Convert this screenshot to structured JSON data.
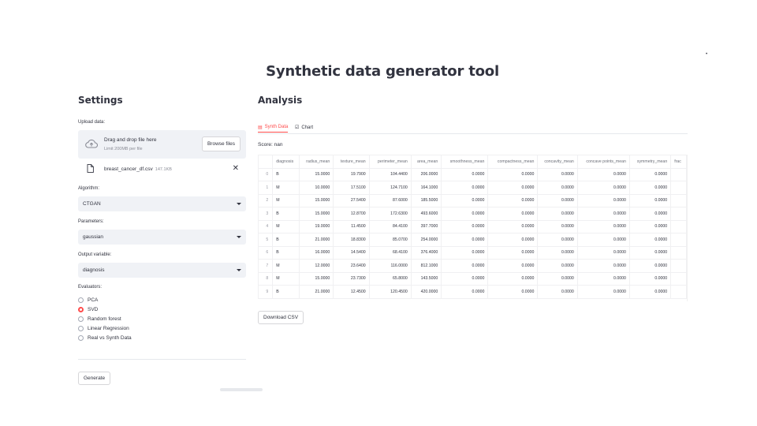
{
  "page": {
    "title": "Synthetic data generator tool",
    "menu_icon": "kebab-menu"
  },
  "sidebar": {
    "heading": "Settings",
    "upload": {
      "label": "Upload data:",
      "drop_text": "Drag and drop file here",
      "limit_text": "Limit 200MB per file",
      "browse_label": "Browse files",
      "file_name": "breast_cancer_df.csv",
      "file_size": "147.1KB"
    },
    "algorithm": {
      "label": "Algorithm:",
      "value": "CTGAN"
    },
    "parameters": {
      "label": "Parameters:",
      "value": "gaussian"
    },
    "output_variable": {
      "label": "Output variable:",
      "value": "diagnosis"
    },
    "evaluators": {
      "label": "Evaluators:",
      "options": [
        "PCA",
        "SVD",
        "Random forest",
        "Linear Regression",
        "Real vs Synth Data"
      ],
      "selected": "SVD"
    },
    "generate_label": "Generate"
  },
  "main": {
    "heading": "Analysis",
    "tabs": [
      {
        "label": "Synth Data",
        "icon": "table-icon",
        "active": true
      },
      {
        "label": "Chart",
        "icon": "chart-icon",
        "active": false
      }
    ],
    "score_text": "Score: nan",
    "table": {
      "columns": [
        "",
        "diagnosis",
        "radius_mean",
        "texture_mean",
        "perimeter_mean",
        "area_mean",
        "smoothness_mean",
        "compactness_mean",
        "concavity_mean",
        "concave points_mean",
        "symmetry_mean",
        "frac"
      ],
      "rows": [
        [
          "0",
          "B",
          "15.0000",
          "19.7900",
          "104.4400",
          "206.0000",
          "0.0000",
          "0.0000",
          "0.0000",
          "0.0000",
          "0.0000",
          ""
        ],
        [
          "1",
          "M",
          "10.0000",
          "17.5100",
          "124.7100",
          "164.1000",
          "0.0000",
          "0.0000",
          "0.0000",
          "0.0000",
          "0.0000",
          ""
        ],
        [
          "2",
          "M",
          "15.0000",
          "27.5400",
          "87.6000",
          "185.5000",
          "0.0000",
          "0.0000",
          "0.0000",
          "0.0000",
          "0.0000",
          ""
        ],
        [
          "3",
          "B",
          "15.0000",
          "12.8700",
          "172.6300",
          "493.6000",
          "0.0000",
          "0.0000",
          "0.0000",
          "0.0000",
          "0.0000",
          ""
        ],
        [
          "4",
          "M",
          "19.0000",
          "11.4500",
          "84.4100",
          "397.7000",
          "0.0000",
          "0.0000",
          "0.0000",
          "0.0000",
          "0.0000",
          ""
        ],
        [
          "5",
          "B",
          "21.0000",
          "18.8300",
          "85.0700",
          "254.0000",
          "0.0000",
          "0.0000",
          "0.0000",
          "0.0000",
          "0.0000",
          ""
        ],
        [
          "6",
          "B",
          "16.0000",
          "14.5400",
          "68.4100",
          "376.4000",
          "0.0000",
          "0.0000",
          "0.0000",
          "0.0000",
          "0.0000",
          ""
        ],
        [
          "7",
          "M",
          "12.0000",
          "23.6400",
          "116.0000",
          "812.1000",
          "0.0000",
          "0.0000",
          "0.0000",
          "0.0000",
          "0.0000",
          ""
        ],
        [
          "8",
          "M",
          "15.0000",
          "23.7300",
          "65.8000",
          "143.5000",
          "0.0000",
          "0.0000",
          "0.0000",
          "0.0000",
          "0.0000",
          ""
        ],
        [
          "9",
          "B",
          "21.0000",
          "12.4500",
          "120.4500",
          "420.0000",
          "0.0000",
          "0.0000",
          "0.0000",
          "0.0000",
          "0.0000",
          ""
        ]
      ]
    },
    "download_label": "Download CSV"
  },
  "colors": {
    "accent": "#ff4b4b",
    "input_bg": "#f0f2f6",
    "text": "#31333f"
  }
}
